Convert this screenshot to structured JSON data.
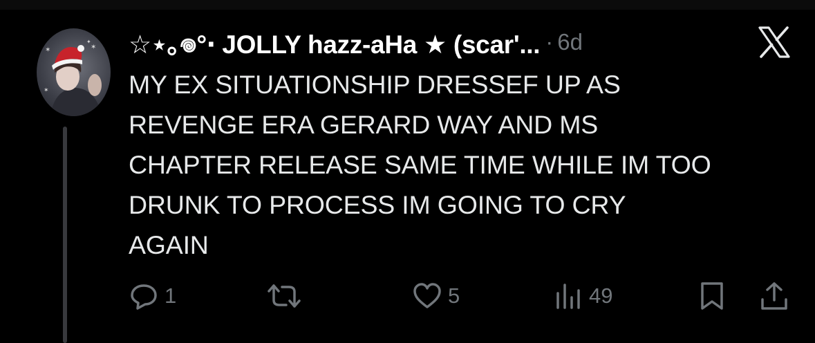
{
  "post": {
    "display_name": "☆⋆｡𖦹°‧ JOLLY hazz-aHa ★ (scar'...",
    "separator": "·",
    "time": "6d",
    "text": "MY EX SITUATIONSHIP DRESSEF UP AS\nREVENGE ERA GERARD WAY AND MS\nCHAPTER RELEASE SAME TIME WHILE IM TOO\nDRUNK TO PROCESS IM GOING TO CRY\nAGAIN",
    "replies": "1",
    "reposts": "",
    "likes": "5",
    "views": "49"
  },
  "icons": {
    "platform": "x-logo-icon",
    "reply": "speech-bubble-icon",
    "repost": "repost-arrows-icon",
    "like": "heart-icon",
    "views": "bar-chart-icon",
    "bookmark": "bookmark-icon",
    "share": "share-upload-icon"
  },
  "colors": {
    "background": "#000000",
    "text_primary": "#e7e9ea",
    "text_secondary": "#71767b",
    "thread_line": "#38393d"
  }
}
